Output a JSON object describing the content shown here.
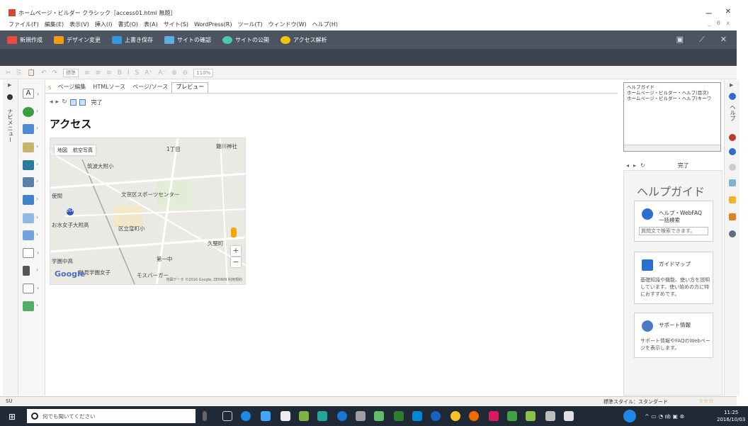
{
  "window": {
    "title": "ホームページ・ビルダー クラシック［access01.html 無題］",
    "controls": [
      "ー",
      "✕"
    ]
  },
  "menubar": {
    "items": [
      "ファイル(F)",
      "編集(E)",
      "表示(V)",
      "挿入(I)",
      "書式(O)",
      "表(A)",
      "サイト(S)",
      "WordPress(R)",
      "ツール(T)",
      "ウィンドウ(W)",
      "ヘルプ(H)"
    ],
    "mdi_controls": [
      "_",
      "θ",
      "x"
    ]
  },
  "command_toolbar": {
    "buttons": [
      {
        "label": "新規作成",
        "icon": "new-page-icon",
        "color": "#e74c3c"
      },
      {
        "label": "デザイン変更",
        "icon": "design-icon",
        "color": "#f39c12"
      },
      {
        "label": "上書き保存",
        "icon": "save-icon",
        "color": "#3498db"
      },
      {
        "label": "サイトの確認",
        "icon": "site-check-icon",
        "color": "#5dade2"
      },
      {
        "label": "サイトの公開",
        "icon": "publish-icon",
        "color": "#48c9b0"
      },
      {
        "label": "アクセス解析",
        "icon": "analytics-icon",
        "color": "#f1c40f"
      }
    ]
  },
  "format_toolbar": {
    "style_combo": "標準",
    "zoom_combo": "110%"
  },
  "left_panel": {
    "title": "ナビメニュー"
  },
  "editor": {
    "tabs": [
      "ページ編集",
      "HTMLソース",
      "ページ/ソース",
      "プレビュー"
    ],
    "active_tab": "プレビュー",
    "badge": "S",
    "preview_done": "完了",
    "heading": "アクセス"
  },
  "map": {
    "type_buttons": [
      "地図",
      "航空写真"
    ],
    "labels": [
      {
        "text": "筑波大附小",
        "id": "l1"
      },
      {
        "text": "文京区スポーツセンター",
        "id": "l2"
      },
      {
        "text": "お水女子大附高",
        "id": "l3"
      },
      {
        "text": "区立窪町小",
        "id": "l4"
      },
      {
        "text": "第一中",
        "id": "l5"
      },
      {
        "text": "久堅町",
        "id": "l6"
      },
      {
        "text": "学園中高",
        "id": "l7"
      },
      {
        "text": "跡見学園女子",
        "id": "l8"
      },
      {
        "text": "モスバーガー",
        "id": "l9"
      },
      {
        "text": "1丁目",
        "id": "l10"
      },
      {
        "text": "簸川神社",
        "id": "l11"
      },
      {
        "text": "使間",
        "id": "l12"
      }
    ],
    "road_shield": "254",
    "logo": "Google",
    "attribution": "地図データ ©2016 Google, ZENRIN 利用規約",
    "zoom_in": "+",
    "zoom_out": "−"
  },
  "help_panel": {
    "tree": [
      "ヘルプガイド",
      "ホームページ・ビルダー・ヘルプ(目次)",
      "ホームページ・ビルダー・ヘルプ(キーワ"
    ],
    "done": "完了",
    "title": "ヘルプガイド",
    "cards": [
      {
        "title": "ヘルプ・WebFAQ 一括検索",
        "input": "質問文で検索できます。",
        "icon": "search-icon"
      },
      {
        "title": "ガイドマップ",
        "desc": "基礎知識や機能、使い方を説明しています。使い始めの方に特におすすめです。",
        "icon": "help-icon"
      },
      {
        "title": "サポート情報",
        "desc": "サポート情報やFAQのWebページを表示します。",
        "icon": "support-icon"
      }
    ]
  },
  "right_panel": {
    "title": "ヘルプ"
  },
  "statusbar": {
    "left": "SU",
    "style": "標準スタイル：スタンダード",
    "stars": "☆☆☆"
  },
  "taskbar": {
    "search_placeholder": "何でも聞いてください",
    "time": "11:25",
    "date": "2016/10/03"
  }
}
